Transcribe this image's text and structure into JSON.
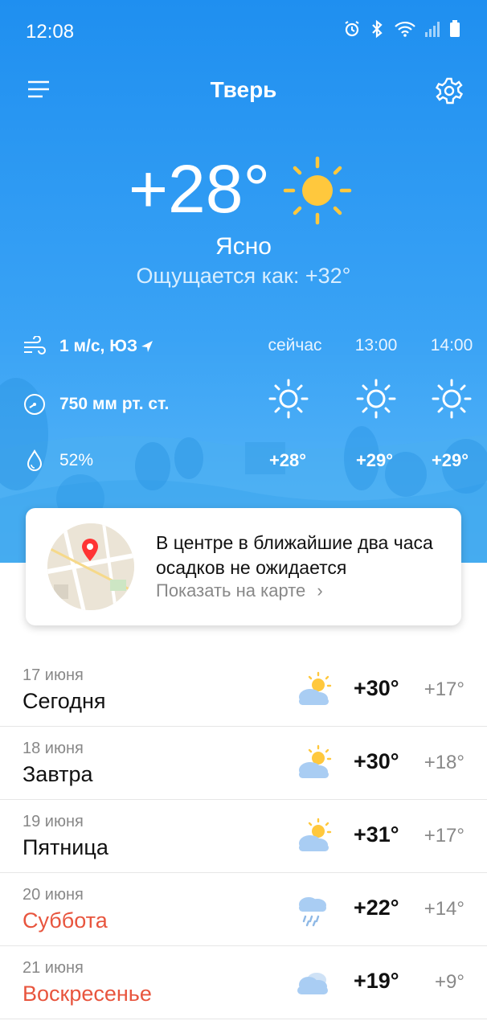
{
  "status": {
    "time": "12:08"
  },
  "header": {
    "city": "Тверь"
  },
  "current": {
    "temp": "+28°",
    "condition": "Ясно",
    "feels_like": "Ощущается как: +32°",
    "wind": "1 м/с, ЮЗ",
    "pressure": "750 мм рт. ст.",
    "humidity": "52%"
  },
  "hourly": [
    {
      "label": "сейчас",
      "temp": "+28°",
      "icon": "sun-icon"
    },
    {
      "label": "13:00",
      "temp": "+29°",
      "icon": "sun-icon"
    },
    {
      "label": "14:00",
      "temp": "+29°",
      "icon": "sun-icon"
    }
  ],
  "nowcast": {
    "text": "В центре в ближайшие два часа осадков не ожидается",
    "link": "Показать на карте"
  },
  "forecast": [
    {
      "date": "17 июня",
      "day": "Сегодня",
      "hi": "+30°",
      "lo": "+17°",
      "icon": "partly-cloudy-icon",
      "weekend": false
    },
    {
      "date": "18 июня",
      "day": "Завтра",
      "hi": "+30°",
      "lo": "+18°",
      "icon": "partly-cloudy-icon",
      "weekend": false
    },
    {
      "date": "19 июня",
      "day": "Пятница",
      "hi": "+31°",
      "lo": "+17°",
      "icon": "partly-cloudy-icon",
      "weekend": false
    },
    {
      "date": "20 июня",
      "day": "Суббота",
      "hi": "+22°",
      "lo": "+14°",
      "icon": "rain-icon",
      "weekend": true
    },
    {
      "date": "21 июня",
      "day": "Воскресенье",
      "hi": "+19°",
      "lo": "+9°",
      "icon": "cloudy-icon",
      "weekend": true
    }
  ],
  "colors": {
    "sky": "#1f8ff0",
    "sun": "#ffc83d",
    "weekend": "#e8553e"
  }
}
